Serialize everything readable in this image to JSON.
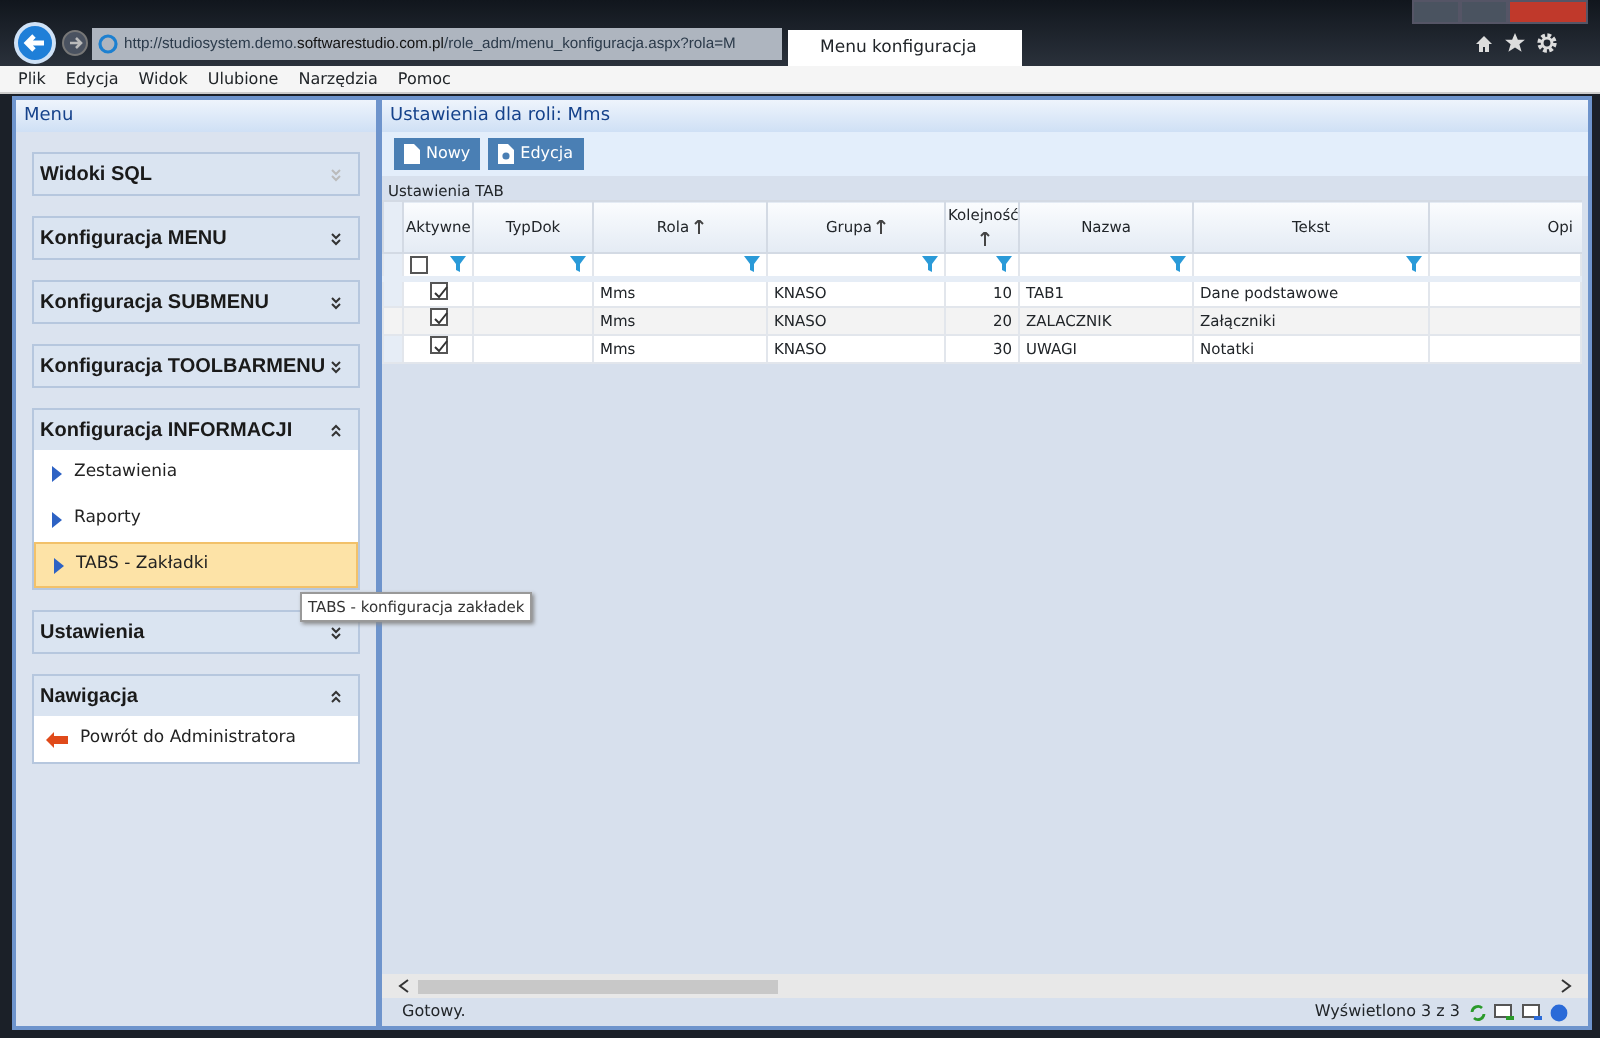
{
  "browser": {
    "url": "http://studiosystem.demo.**softwarestudio.com.pl**/role_adm/menu_konfiguracja.aspx?rola=M",
    "tab_title": "Menu konfiguracja"
  },
  "menu_bar": [
    "Plik",
    "Edycja",
    "Widok",
    "Ulubione",
    "Narzędzia",
    "Pomoc"
  ],
  "sidebar": {
    "title": "Menu",
    "sections": [
      {
        "title": "Widoki SQL",
        "expanded": false,
        "disabled": true
      },
      {
        "title": "Konfiguracja MENU",
        "expanded": false,
        "disabled": false
      },
      {
        "title": "Konfiguracja SUBMENU",
        "expanded": false,
        "disabled": false
      },
      {
        "title": "Konfiguracja TOOLBARMENU",
        "expanded": false,
        "disabled": false
      },
      {
        "title": "Konfiguracja INFORMACJI",
        "expanded": true,
        "disabled": false,
        "items": [
          {
            "label": "Zestawienia",
            "kind": "arrow",
            "selected": false
          },
          {
            "label": "Raporty",
            "kind": "arrow",
            "selected": false
          },
          {
            "label": "TABS - Zakładki",
            "kind": "arrow",
            "selected": true,
            "tooltip": "TABS - konfiguracja zakładek"
          }
        ]
      },
      {
        "title": "Ustawienia",
        "expanded": false,
        "disabled": false
      },
      {
        "title": "Nawigacja",
        "expanded": true,
        "disabled": false,
        "items": [
          {
            "label": "Powrót do Administratora",
            "kind": "back",
            "selected": false
          }
        ]
      }
    ]
  },
  "main": {
    "title": "Ustawienia dla roli: Mms",
    "toolbar": [
      {
        "label": "Nowy",
        "kind": "new"
      },
      {
        "label": "Edycja",
        "kind": "edit"
      }
    ],
    "grid": {
      "caption": "Ustawienia TAB",
      "columns": [
        {
          "label": "Aktywne",
          "sorted": false,
          "kind": "check"
        },
        {
          "label": "TypDok",
          "sorted": false,
          "kind": "text"
        },
        {
          "label": "Rola",
          "sorted": true,
          "kind": "text"
        },
        {
          "label": "Grupa",
          "sorted": true,
          "kind": "text"
        },
        {
          "label": "Kolejność",
          "sorted": true,
          "kind": "number"
        },
        {
          "label": "Nazwa",
          "sorted": false,
          "kind": "text"
        },
        {
          "label": "Tekst",
          "sorted": false,
          "kind": "text"
        },
        {
          "label": "Opi",
          "sorted": false,
          "kind": "text"
        }
      ],
      "filter_checked": false,
      "rows": [
        {
          "checked": true,
          "cells": [
            "",
            "",
            "Mms",
            "KNASO",
            "10",
            "TAB1",
            "Dane podstawowe",
            ""
          ]
        },
        {
          "checked": true,
          "cells": [
            "",
            "",
            "Mms",
            "KNASO",
            "20",
            "ZALACZNIK",
            "Załączniki",
            ""
          ]
        },
        {
          "checked": true,
          "cells": [
            "",
            "",
            "Mms",
            "KNASO",
            "30",
            "UWAGI",
            "Notatki",
            ""
          ]
        }
      ]
    },
    "status": "Gotowy.",
    "count": "Wyświetlono 3 z 3"
  }
}
